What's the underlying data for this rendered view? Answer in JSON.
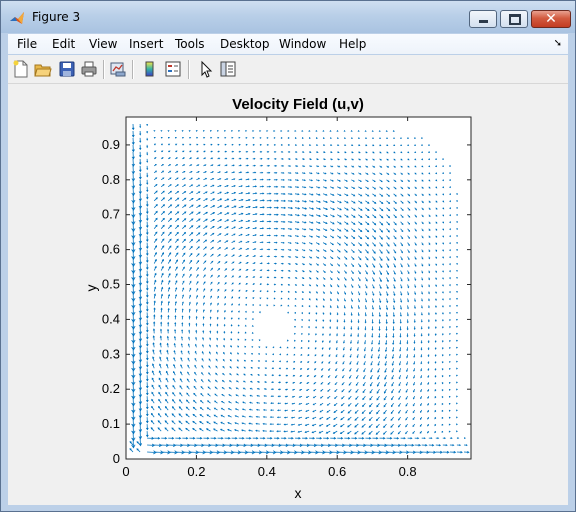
{
  "window": {
    "title": "Figure 3",
    "minimize_icon": "minimize-icon",
    "maximize_icon": "maximize-icon",
    "close_icon": "close-icon"
  },
  "menubar": {
    "items": [
      "File",
      "Edit",
      "View",
      "Insert",
      "Tools",
      "Desktop",
      "Window",
      "Help"
    ],
    "overflow_icon": "menu-overflow-arrow-icon"
  },
  "toolbar": {
    "icons": [
      "new-figure-icon",
      "open-file-icon",
      "save-icon",
      "print-icon",
      "link-plot-icon",
      "insert-colorbar-icon",
      "insert-legend-icon",
      "edit-plot-icon",
      "property-editor-icon"
    ]
  },
  "chart_data": {
    "type": "quiver",
    "title": "Velocity Field (u,v)",
    "xlabel": "x",
    "ylabel": "y",
    "xlim": [
      0,
      0.98
    ],
    "ylim": [
      0,
      0.98
    ],
    "xticks": [
      "0",
      "0.2",
      "0.4",
      "0.6",
      "0.8"
    ],
    "yticks": [
      "0",
      "0.1",
      "0.2",
      "0.3",
      "0.4",
      "0.5",
      "0.6",
      "0.7",
      "0.8",
      "0.9"
    ],
    "grid": false,
    "color": "#0072bd",
    "vortex_center": [
      0.42,
      0.38
    ],
    "grid_spacing": 0.02,
    "note_field": "clockwise lid-driven-cavity-like circulation with strong flow along left and bottom walls"
  },
  "colors": {
    "axes_bg": "#ffffff",
    "figure_bg": "#f0f0f0",
    "arrow": "#0072bd"
  }
}
